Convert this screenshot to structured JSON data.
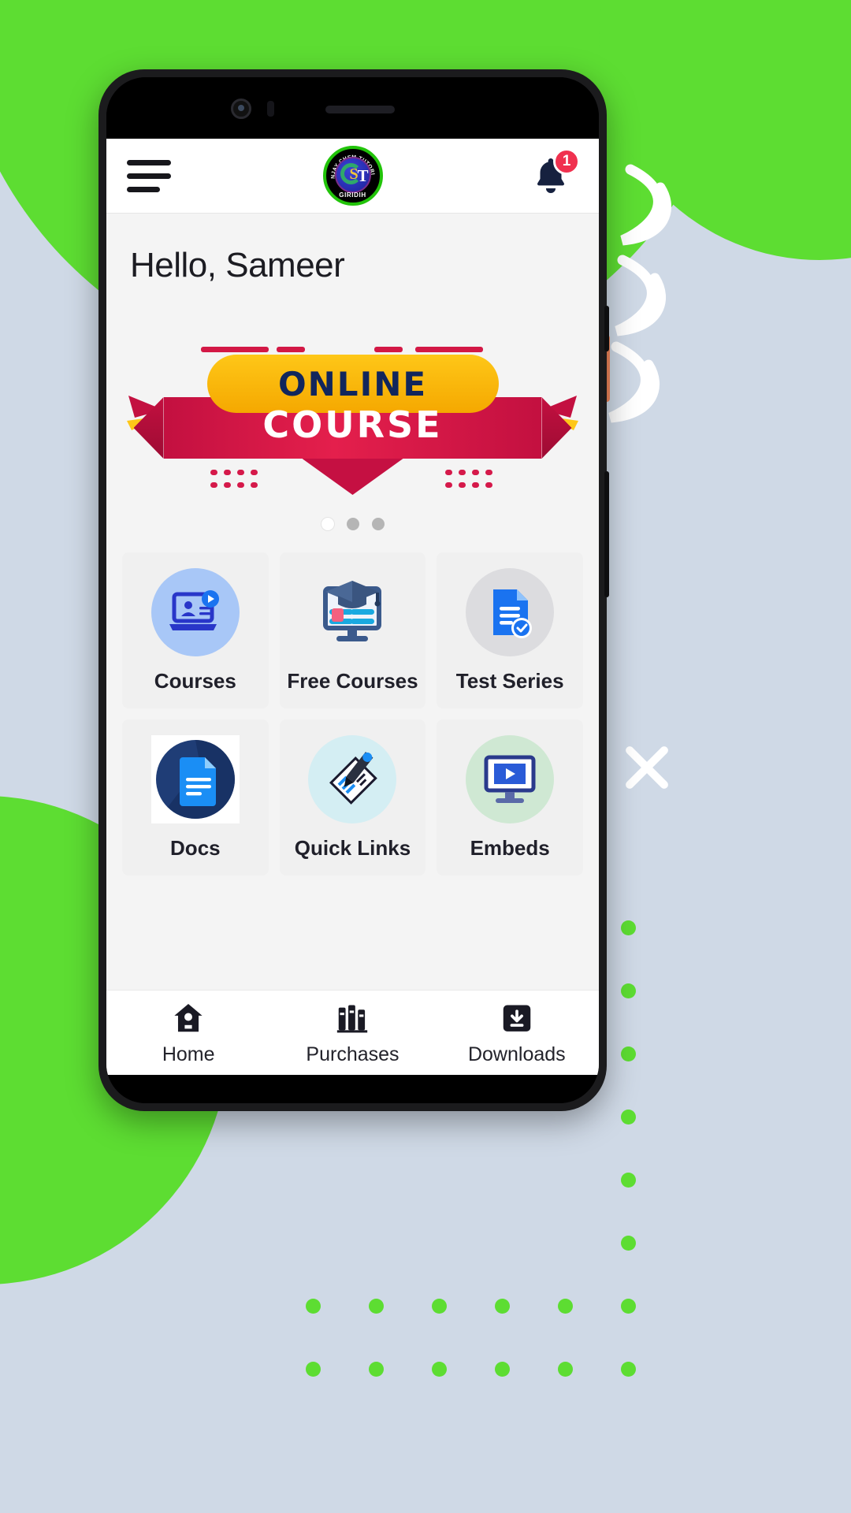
{
  "app": {
    "header": {
      "menu_icon": "hamburger-menu-icon",
      "logo": {
        "ring_text": "SANJAY CHEM TUTORIALS",
        "monogram": "ST",
        "city": "GIRIDIH"
      },
      "notification": {
        "icon": "bell-icon",
        "badge_count": "1"
      }
    },
    "greeting": "Hello, Sameer",
    "carousel": {
      "banner": {
        "line1": "ONLINE",
        "line2": "COURSE"
      },
      "dots": [
        {
          "active": true
        },
        {
          "active": false
        },
        {
          "active": false
        }
      ]
    },
    "tiles": [
      {
        "label": "Courses",
        "icon": "laptop-video-icon"
      },
      {
        "label": "Free Courses",
        "icon": "monitor-graduation-cap-icon"
      },
      {
        "label": "Test Series",
        "icon": "document-check-icon"
      },
      {
        "label": "Docs",
        "icon": "document-icon"
      },
      {
        "label": "Quick Links",
        "icon": "pen-note-icon"
      },
      {
        "label": "Embeds",
        "icon": "monitor-play-icon"
      }
    ],
    "bottom_nav": [
      {
        "label": "Home",
        "icon": "home-icon"
      },
      {
        "label": "Purchases",
        "icon": "books-icon"
      },
      {
        "label": "Downloads",
        "icon": "download-box-icon"
      }
    ]
  },
  "colors": {
    "background_green": "#5ddd32",
    "background_blue": "#cfd9e6",
    "badge_red": "#f0314f",
    "banner_yellow": "#fec718",
    "banner_red": "#d31845",
    "banner_navy": "#11265c",
    "tile_bg": "#f0f0f0"
  }
}
